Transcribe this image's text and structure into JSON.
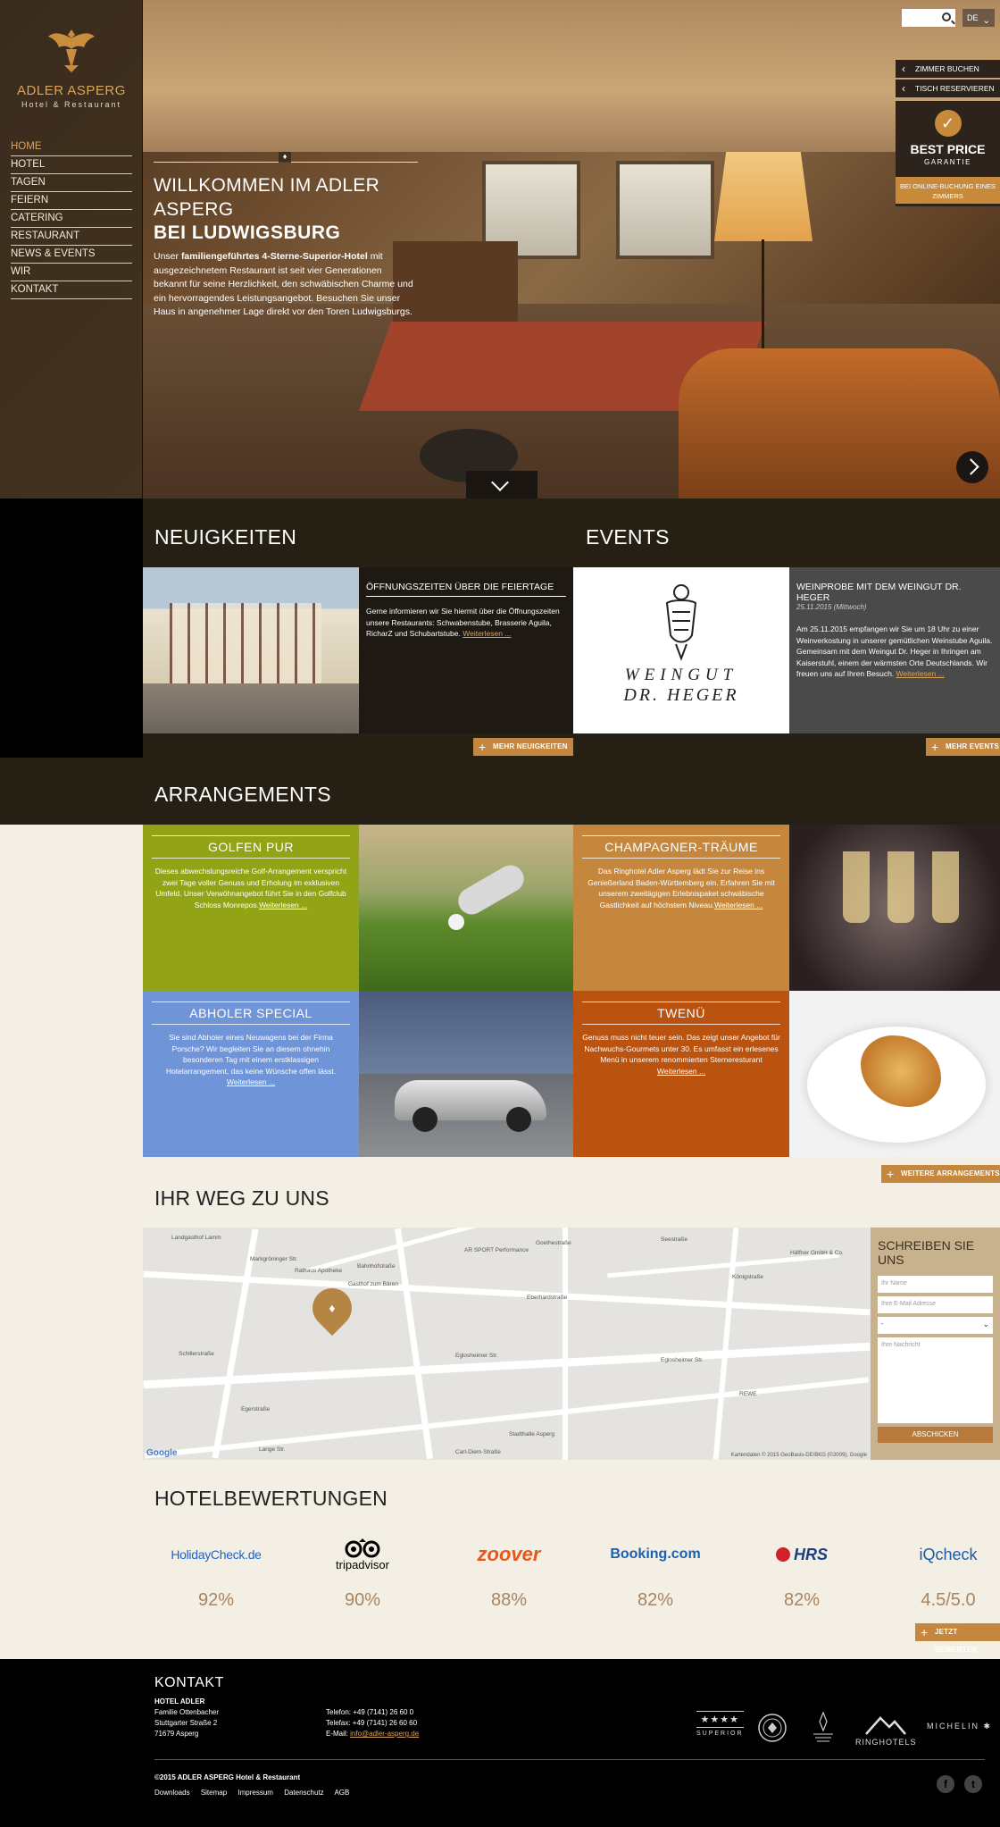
{
  "brand": {
    "name": "ADLER ASPERG",
    "subtitle": "Hotel & Restaurant"
  },
  "nav": {
    "items": [
      "HOME",
      "HOTEL",
      "TAGEN",
      "FEIERN",
      "CATERING",
      "RESTAURANT",
      "NEWS & EVENTS",
      "WIR",
      "KONTAKT"
    ],
    "active": "HOME"
  },
  "topbar": {
    "search_placeholder": "",
    "language": "DE"
  },
  "hero": {
    "title_line1": "WILLKOMMEN IM ADLER ASPERG",
    "title_line2": "BEI LUDWIGSBURG",
    "intro_before": "Unser ",
    "intro_bold": "familiengeführtes 4-Sterne-Superior-Hotel",
    "intro_after": " mit ausgezeichnetem Restaurant ist seit vier Generationen bekannt für seine Herzlichkeit, den schwäbischen Charme und ein hervorragendes Leistungsangebot. Besuchen Sie unser Haus in angenehmer Lage direkt vor den Toren Ludwigsburgs."
  },
  "side_actions": {
    "book_room": "ZIMMER BUCHEN",
    "reserve_table": "TISCH RESERVIEREN",
    "best_price_title": "BEST PRICE",
    "best_price_sub": "GARANTIE",
    "best_price_note": "BEI ONLINE-BUCHUNG EINES ZIMMERS"
  },
  "news": {
    "section_title": "NEUIGKEITEN",
    "item_title": "ÖFFNUNGSZEITEN ÜBER DIE FEIERTAGE",
    "item_text": "Gerne informieren wir Sie hiermit über die Öffnungszeiten unsere Restaurants: Schwabenstube, Brasserie Aguila, RicharZ und Schubartstube.",
    "read_more": "Weiterlesen ...",
    "more_button": "MEHR NEUIGKEITEN"
  },
  "events": {
    "section_title": "EVENTS",
    "logo_line1": "WEINGUT",
    "logo_line2": "DR. HEGER",
    "item_title": "WEINPROBE MIT DEM WEINGUT DR. HEGER",
    "item_date": "25.11.2015 (Mittwoch)",
    "item_text": "Am 25.11.2015 empfangen wir Sie um 18 Uhr zu einer Weinverkostung in unserer gemütlichen Weinstube Aguila. Gemeinsam mit dem Weingut Dr. Heger in Ihringen am Kaiserstuhl, einem der wärmsten Orte Deutschlands. Wir freuen uns auf Ihren Besuch.",
    "read_more": "Weiterlesen ...",
    "more_button": "MEHR EVENTS"
  },
  "arrangements": {
    "section_title": "ARRANGEMENTS",
    "items": [
      {
        "title": "GOLFEN PUR",
        "text": "Dieses abwechslungsreiche Golf-Arrangement verspricht zwei Tage voller Genuss und Erholung im exklusiven Umfeld. Unser Verwöhnangebot führt Sie in den Golfclub Schloss Monrepos.",
        "link": "Weiterlesen ...",
        "color": "#93a316"
      },
      {
        "title": "CHAMPAGNER-TRÄUME",
        "text": "Das Ringhotel Adler Asperg lädt Sie zur Reise ins Genießerland Baden-Württemberg ein. Erfahren Sie mit unserem zweitägigen Erlebnispaket schwäbische Gastlichkeit auf höchstem Niveau.",
        "link": "Weiterlesen ...",
        "color": "#c4873d"
      },
      {
        "title": "ABHOLER SPECIAL",
        "text": "Sie sind Abholer eines Neuwagens bei der Firma Porsche? Wir begleiten Sie an diesem ohnehin besonderen Tag mit einem erstklassigen Hotelarrangement, das keine Wünsche offen lässt.",
        "link": "Weiterlesen ...",
        "color": "#6f94d8"
      },
      {
        "title": "TWENÜ",
        "text": "Genuss muss nicht teuer sein. Das zeigt unser Angebot für Nachwuchs-Gourmets unter 30. Es umfasst ein erlesenes Menü in unserem renommierten Sterneresturant",
        "link": "Weiterlesen ...",
        "color": "#b9530f"
      }
    ],
    "more_button": "WEITERE ARRANGEMENTS"
  },
  "directions": {
    "section_title": "IHR WEG ZU UNS",
    "map_labels": [
      "Eglosheimer Str.",
      "Schillerstraße",
      "Eberhardstraße",
      "Bahnhofstraße",
      "Markgröninger Str.",
      "Seestraße",
      "Egerstraße",
      "Lange Str.",
      "Carl-Diem-Straße",
      "Königstraße",
      "Goethestraße",
      "Gasthof zum Bären",
      "Rathaus Apotheke",
      "Landgasthof Lamm",
      "Stadthalle Asperg",
      "REWE",
      "Häffner GmbH & Co.",
      "AR SPORT Performance"
    ],
    "google": "Google",
    "map_copyright": "Kartendaten © 2015 GeoBasis-DE/BKG (©2009), Google"
  },
  "contact_form": {
    "title": "SCHREIBEN SIE UNS",
    "name_placeholder": "Ihr Name",
    "email_placeholder": "Ihre E-Mail Adresse",
    "select_value": "-",
    "message_placeholder": "Ihre Nachricht",
    "submit": "ABSCHICKEN"
  },
  "reviews": {
    "section_title": "HOTELBEWERTUNGEN",
    "items": [
      {
        "name": "HolidayCheck.de",
        "score": "92%",
        "color": "#1e64c8"
      },
      {
        "name": "tripadvisor",
        "score": "90%",
        "color": "#000000"
      },
      {
        "name": "zoover",
        "score": "88%",
        "color": "#e8561b"
      },
      {
        "name": "Booking.com",
        "score": "82%",
        "color": "#1b5fae"
      },
      {
        "name": "HRS",
        "score": "82%",
        "color": "#1b3f86"
      },
      {
        "name": "iQcheck",
        "score": "4.5/5.0",
        "color": "#1c5aa8"
      }
    ],
    "rate_button": "JETZT BEWERTEN"
  },
  "footer": {
    "title": "KONTAKT",
    "hotel_name": "HOTEL ADLER",
    "address_lines": [
      "Familie Ottenbacher",
      "Stuttgarter Straße 2",
      "71679 Asperg"
    ],
    "phone": "Telefon: +49 (7141) 26 60 0",
    "fax": "Telefax: +49 (7141) 26 60 60",
    "email_label": "E-Mail: ",
    "email": "info@adler-asperg.de",
    "badges": [
      "SUPERIOR",
      "RINGHOTELS",
      "MICHELIN"
    ],
    "copyright": "©2015 ADLER ASPERG Hotel & Restaurant",
    "links": [
      "Downloads",
      "Sitemap",
      "Impressum",
      "Datenschutz",
      "AGB"
    ]
  }
}
